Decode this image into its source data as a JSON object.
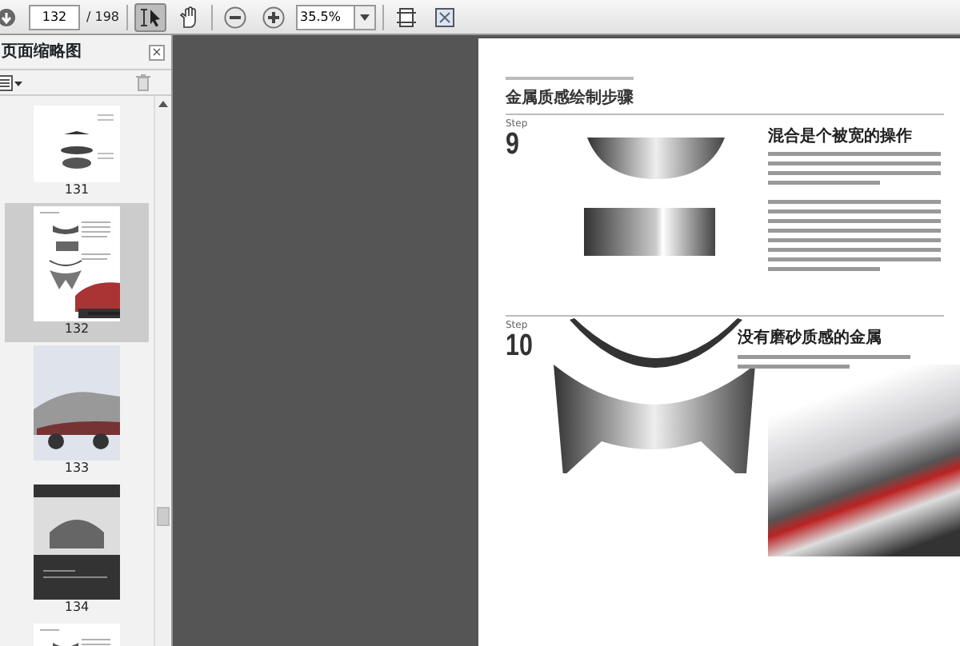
{
  "toolbar": {
    "page_number": "132",
    "page_total": "/ 198",
    "tools": [
      {
        "kind": "select",
        "selected": true
      },
      {
        "kind": "hand",
        "selected": false
      }
    ],
    "zoom": "35.5%"
  },
  "sidebar": {
    "title": "页面缩略图",
    "close": "×",
    "thumbnails": [
      {
        "kind": "shapes",
        "label": "131",
        "selected": false
      },
      {
        "kind": "layout",
        "label": "132",
        "selected": true
      },
      {
        "kind": "photo",
        "label": "133",
        "selected": false
      },
      {
        "kind": "dark",
        "label": "134",
        "selected": false
      },
      {
        "kind": "layout",
        "selected": false
      }
    ]
  },
  "document": {
    "title": "金属质感绘制步骤",
    "steps": [
      {
        "kind": "bowl",
        "label": "Step",
        "number": "9",
        "heading": "混合是个被宽的操作"
      },
      {
        "kind": "collar",
        "label": "Step",
        "number": "10",
        "heading": "没有磨砂质感的金属"
      }
    ]
  }
}
